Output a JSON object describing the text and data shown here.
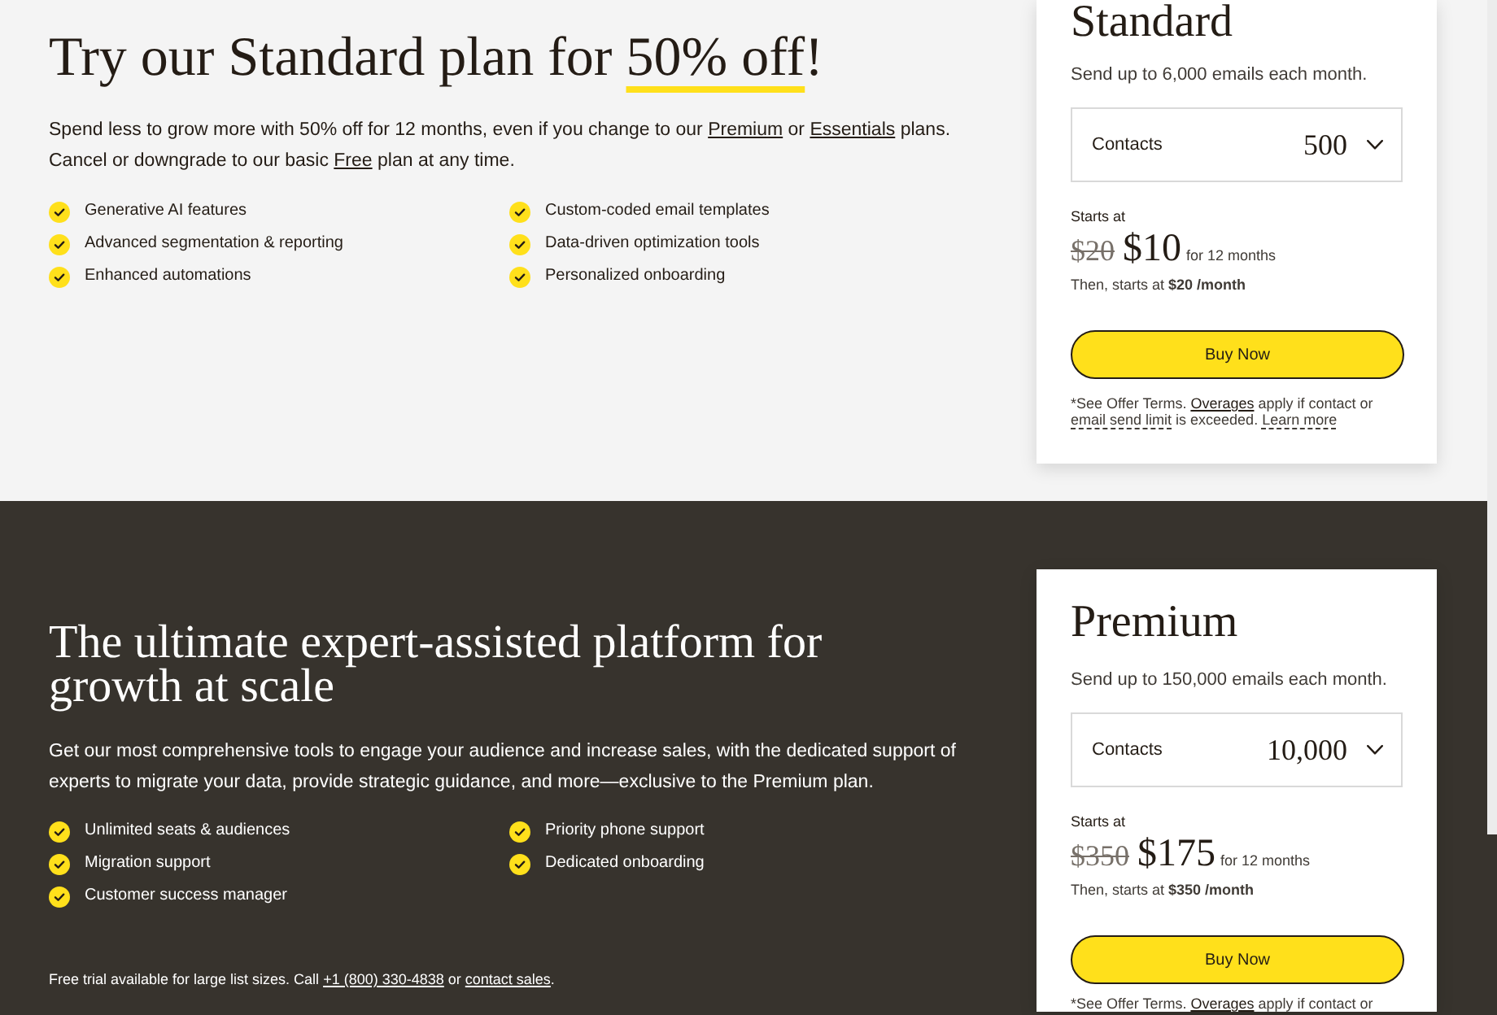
{
  "standard_offer": {
    "heading": [
      {
        "text": "Try our Standard plan for ",
        "highlight": false
      },
      {
        "text": "50% off",
        "highlight": true
      },
      {
        "text": "!",
        "highlight": false
      }
    ],
    "description": [
      {
        "kind": "text",
        "text": "Spend less to grow more with 50% off for 12 months, even if you change to our "
      },
      {
        "kind": "link",
        "text": "Premium"
      },
      {
        "kind": "text",
        "text": " or "
      },
      {
        "kind": "link",
        "text": "Essentials"
      },
      {
        "kind": "text",
        "text": " plans. Cancel or downgrade to our basic "
      },
      {
        "kind": "link",
        "text": "Free"
      },
      {
        "kind": "text",
        "text": " plan at any time."
      }
    ],
    "features": [
      "Generative AI features",
      "Custom-coded email templates",
      "Advanced segmentation & reporting",
      "Data-driven optimization tools",
      "Enhanced automations",
      "Personalized onboarding"
    ]
  },
  "standard_card": {
    "title": "Standard",
    "description": "Send up to 6,000 emails each month.",
    "contacts": {
      "label": "Contacts",
      "value": "500"
    },
    "starts_label": "Starts at",
    "original_price": "$20",
    "price": "$10",
    "price_note": "for 12 months",
    "renewal": "Then, starts at **$20 /month**",
    "button": "Buy Now",
    "footnote": [
      {
        "kind": "text",
        "text": "*See Offer Terms. "
      },
      {
        "kind": "link",
        "text": "Overages"
      },
      {
        "kind": "text",
        "text": " apply if contact or "
      },
      {
        "kind": "term",
        "text": "email send limit"
      },
      {
        "kind": "text",
        "text": " is exceeded. "
      },
      {
        "kind": "term",
        "text": "Learn more"
      }
    ]
  },
  "premium_offer": {
    "heading": "The ultimate expert-assisted platform for growth at scale",
    "description": "Get our most comprehensive tools to engage your audience and increase sales, with the dedicated support of experts to migrate your data, provide strategic guidance, and more—exclusive to the Premium plan.",
    "features": [
      "Unlimited seats & audiences",
      "Priority phone support",
      "Migration support",
      "Dedicated onboarding",
      "Customer success manager"
    ],
    "footer": [
      {
        "kind": "text",
        "text": "Free trial available for large list sizes. Call "
      },
      {
        "kind": "link",
        "text": "+1 (800) 330-4838"
      },
      {
        "kind": "text",
        "text": " or "
      },
      {
        "kind": "link",
        "text": "contact sales"
      },
      {
        "kind": "text",
        "text": "."
      }
    ]
  },
  "premium_card": {
    "title": "Premium",
    "description": "Send up to 150,000 emails each month.",
    "contacts": {
      "label": "Contacts",
      "value": "10,000"
    },
    "starts_label": "Starts at",
    "original_price": "$350",
    "price": "$175",
    "price_note": "for 12 months",
    "renewal": "Then, starts at **$350 /month**",
    "button": "Buy Now",
    "footnote": [
      {
        "kind": "text",
        "text": "*See Offer Terms. "
      },
      {
        "kind": "link",
        "text": "Overages"
      },
      {
        "kind": "text",
        "text": " apply if contact or"
      }
    ]
  }
}
